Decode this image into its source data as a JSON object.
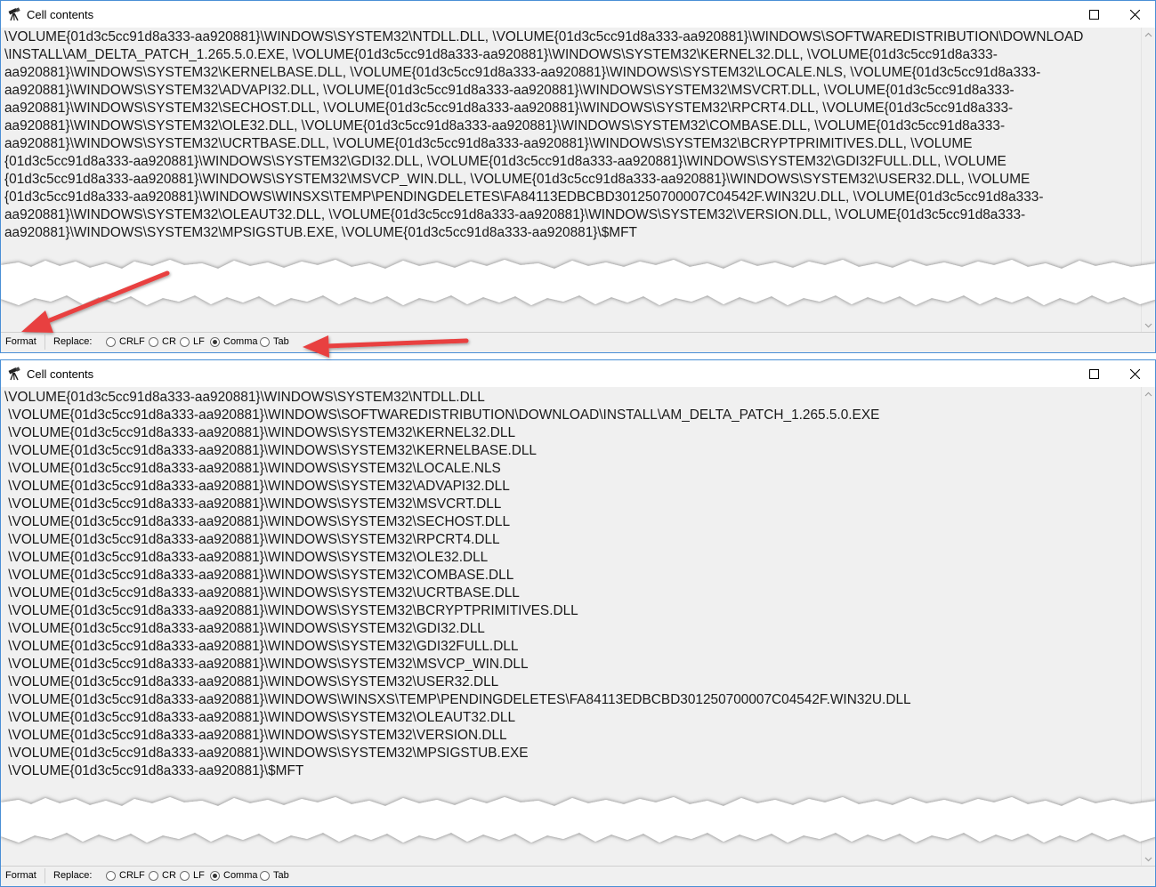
{
  "windows": [
    {
      "title": "Cell contents",
      "mode": "raw",
      "text": "\\VOLUME{01d3c5cc91d8a333-aa920881}\\WINDOWS\\SYSTEM32\\NTDLL.DLL, \\VOLUME{01d3c5cc91d8a333-aa920881}\\WINDOWS\\SOFTWAREDISTRIBUTION\\DOWNLOAD\n\\INSTALL\\AM_DELTA_PATCH_1.265.5.0.EXE, \\VOLUME{01d3c5cc91d8a333-aa920881}\\WINDOWS\\SYSTEM32\\KERNEL32.DLL, \\VOLUME{01d3c5cc91d8a333-\naa920881}\\WINDOWS\\SYSTEM32\\KERNELBASE.DLL, \\VOLUME{01d3c5cc91d8a333-aa920881}\\WINDOWS\\SYSTEM32\\LOCALE.NLS, \\VOLUME{01d3c5cc91d8a333-\naa920881}\\WINDOWS\\SYSTEM32\\ADVAPI32.DLL, \\VOLUME{01d3c5cc91d8a333-aa920881}\\WINDOWS\\SYSTEM32\\MSVCRT.DLL, \\VOLUME{01d3c5cc91d8a333-\naa920881}\\WINDOWS\\SYSTEM32\\SECHOST.DLL, \\VOLUME{01d3c5cc91d8a333-aa920881}\\WINDOWS\\SYSTEM32\\RPCRT4.DLL, \\VOLUME{01d3c5cc91d8a333-\naa920881}\\WINDOWS\\SYSTEM32\\OLE32.DLL, \\VOLUME{01d3c5cc91d8a333-aa920881}\\WINDOWS\\SYSTEM32\\COMBASE.DLL, \\VOLUME{01d3c5cc91d8a333-\naa920881}\\WINDOWS\\SYSTEM32\\UCRTBASE.DLL, \\VOLUME{01d3c5cc91d8a333-aa920881}\\WINDOWS\\SYSTEM32\\BCRYPTPRIMITIVES.DLL, \\VOLUME\n{01d3c5cc91d8a333-aa920881}\\WINDOWS\\SYSTEM32\\GDI32.DLL, \\VOLUME{01d3c5cc91d8a333-aa920881}\\WINDOWS\\SYSTEM32\\GDI32FULL.DLL, \\VOLUME\n{01d3c5cc91d8a333-aa920881}\\WINDOWS\\SYSTEM32\\MSVCP_WIN.DLL, \\VOLUME{01d3c5cc91d8a333-aa920881}\\WINDOWS\\SYSTEM32\\USER32.DLL, \\VOLUME\n{01d3c5cc91d8a333-aa920881}\\WINDOWS\\WINSXS\\TEMP\\PENDINGDELETES\\FA84113EDBCBD301250700007C04542F.WIN32U.DLL, \\VOLUME{01d3c5cc91d8a333-\naa920881}\\WINDOWS\\SYSTEM32\\OLEAUT32.DLL, \\VOLUME{01d3c5cc91d8a333-aa920881}\\WINDOWS\\SYSTEM32\\VERSION.DLL, \\VOLUME{01d3c5cc91d8a333-\naa920881}\\WINDOWS\\SYSTEM32\\MPSIGSTUB.EXE, \\VOLUME{01d3c5cc91d8a333-aa920881}\\$MFT",
      "status": {
        "format_label": "Format",
        "replace_label": "Replace:",
        "options": [
          "CRLF",
          "CR",
          "LF",
          "Comma",
          "Tab"
        ],
        "selected": "Comma"
      }
    },
    {
      "title": "Cell contents",
      "mode": "formatted",
      "lines": [
        "\\VOLUME{01d3c5cc91d8a333-aa920881}\\WINDOWS\\SYSTEM32\\NTDLL.DLL",
        " \\VOLUME{01d3c5cc91d8a333-aa920881}\\WINDOWS\\SOFTWAREDISTRIBUTION\\DOWNLOAD\\INSTALL\\AM_DELTA_PATCH_1.265.5.0.EXE",
        " \\VOLUME{01d3c5cc91d8a333-aa920881}\\WINDOWS\\SYSTEM32\\KERNEL32.DLL",
        " \\VOLUME{01d3c5cc91d8a333-aa920881}\\WINDOWS\\SYSTEM32\\KERNELBASE.DLL",
        " \\VOLUME{01d3c5cc91d8a333-aa920881}\\WINDOWS\\SYSTEM32\\LOCALE.NLS",
        " \\VOLUME{01d3c5cc91d8a333-aa920881}\\WINDOWS\\SYSTEM32\\ADVAPI32.DLL",
        " \\VOLUME{01d3c5cc91d8a333-aa920881}\\WINDOWS\\SYSTEM32\\MSVCRT.DLL",
        " \\VOLUME{01d3c5cc91d8a333-aa920881}\\WINDOWS\\SYSTEM32\\SECHOST.DLL",
        " \\VOLUME{01d3c5cc91d8a333-aa920881}\\WINDOWS\\SYSTEM32\\RPCRT4.DLL",
        " \\VOLUME{01d3c5cc91d8a333-aa920881}\\WINDOWS\\SYSTEM32\\OLE32.DLL",
        " \\VOLUME{01d3c5cc91d8a333-aa920881}\\WINDOWS\\SYSTEM32\\COMBASE.DLL",
        " \\VOLUME{01d3c5cc91d8a333-aa920881}\\WINDOWS\\SYSTEM32\\UCRTBASE.DLL",
        " \\VOLUME{01d3c5cc91d8a333-aa920881}\\WINDOWS\\SYSTEM32\\BCRYPTPRIMITIVES.DLL",
        " \\VOLUME{01d3c5cc91d8a333-aa920881}\\WINDOWS\\SYSTEM32\\GDI32.DLL",
        " \\VOLUME{01d3c5cc91d8a333-aa920881}\\WINDOWS\\SYSTEM32\\GDI32FULL.DLL",
        " \\VOLUME{01d3c5cc91d8a333-aa920881}\\WINDOWS\\SYSTEM32\\MSVCP_WIN.DLL",
        " \\VOLUME{01d3c5cc91d8a333-aa920881}\\WINDOWS\\SYSTEM32\\USER32.DLL",
        " \\VOLUME{01d3c5cc91d8a333-aa920881}\\WINDOWS\\WINSXS\\TEMP\\PENDINGDELETES\\FA84113EDBCBD301250700007C04542F.WIN32U.DLL",
        " \\VOLUME{01d3c5cc91d8a333-aa920881}\\WINDOWS\\SYSTEM32\\OLEAUT32.DLL",
        " \\VOLUME{01d3c5cc91d8a333-aa920881}\\WINDOWS\\SYSTEM32\\VERSION.DLL",
        " \\VOLUME{01d3c5cc91d8a333-aa920881}\\WINDOWS\\SYSTEM32\\MPSIGSTUB.EXE",
        " \\VOLUME{01d3c5cc91d8a333-aa920881}\\$MFT"
      ],
      "status": {
        "format_label": "Format",
        "replace_label": "Replace:",
        "options": [
          "CRLF",
          "CR",
          "LF",
          "Comma",
          "Tab"
        ],
        "selected": "Comma"
      }
    }
  ],
  "colors": {
    "window_border": "#4a8fd6",
    "arrow": "#e8403f",
    "background": "#f0f0f0"
  },
  "icons": {
    "title": "telescope-icon",
    "maximize": "maximize-icon",
    "close": "close-icon",
    "scroll_up": "chevron-up-icon",
    "scroll_down": "chevron-down-icon"
  }
}
